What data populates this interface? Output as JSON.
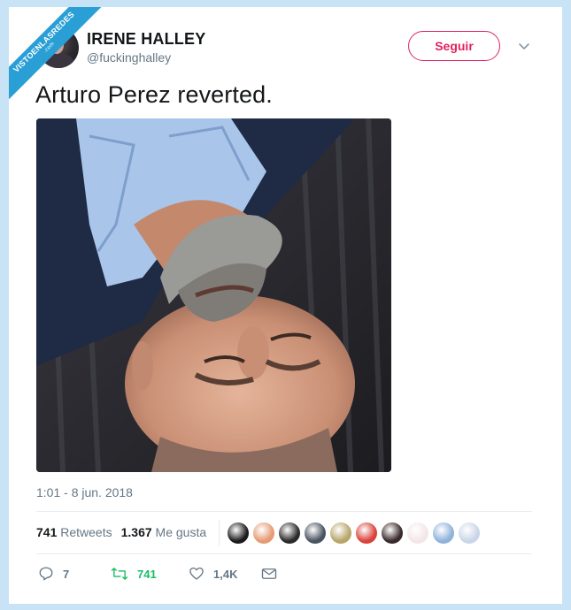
{
  "watermark": {
    "line1": "VISTOENLASREDES",
    "line2": ".com"
  },
  "author": {
    "name": "IRENE HALLEY",
    "handle": "@fuckinghalley"
  },
  "follow_label": "Seguir",
  "tweet_text": "Arturo Perez reverted.",
  "timestamp": "1:01 - 8 jun. 2018",
  "stats": {
    "retweets_count": "741",
    "retweets_label": "Retweets",
    "likes_count": "1.367",
    "likes_label": "Me gusta"
  },
  "likers": [
    {
      "icon": "liker-avatar-1",
      "color": "#1b1b1d"
    },
    {
      "icon": "liker-avatar-2",
      "color": "#e69a73"
    },
    {
      "icon": "liker-avatar-3",
      "color": "#2a2a2a"
    },
    {
      "icon": "liker-avatar-4",
      "color": "#4a5460"
    },
    {
      "icon": "liker-avatar-5",
      "color": "#b7a66a"
    },
    {
      "icon": "liker-avatar-6",
      "color": "#d9423b"
    },
    {
      "icon": "liker-avatar-7",
      "color": "#3a2a2a"
    },
    {
      "icon": "liker-avatar-8",
      "color": "#f3e6e8"
    },
    {
      "icon": "liker-avatar-9",
      "color": "#8fb2dc"
    },
    {
      "icon": "liker-avatar-10",
      "color": "#c9d6e8"
    }
  ],
  "actions": {
    "reply_count": "7",
    "retweet_count": "741",
    "like_count": "1,4K"
  },
  "colors": {
    "accent": "#e0245e",
    "retweet": "#17bf63",
    "muted": "#657786",
    "background": "#c7e3f5"
  }
}
